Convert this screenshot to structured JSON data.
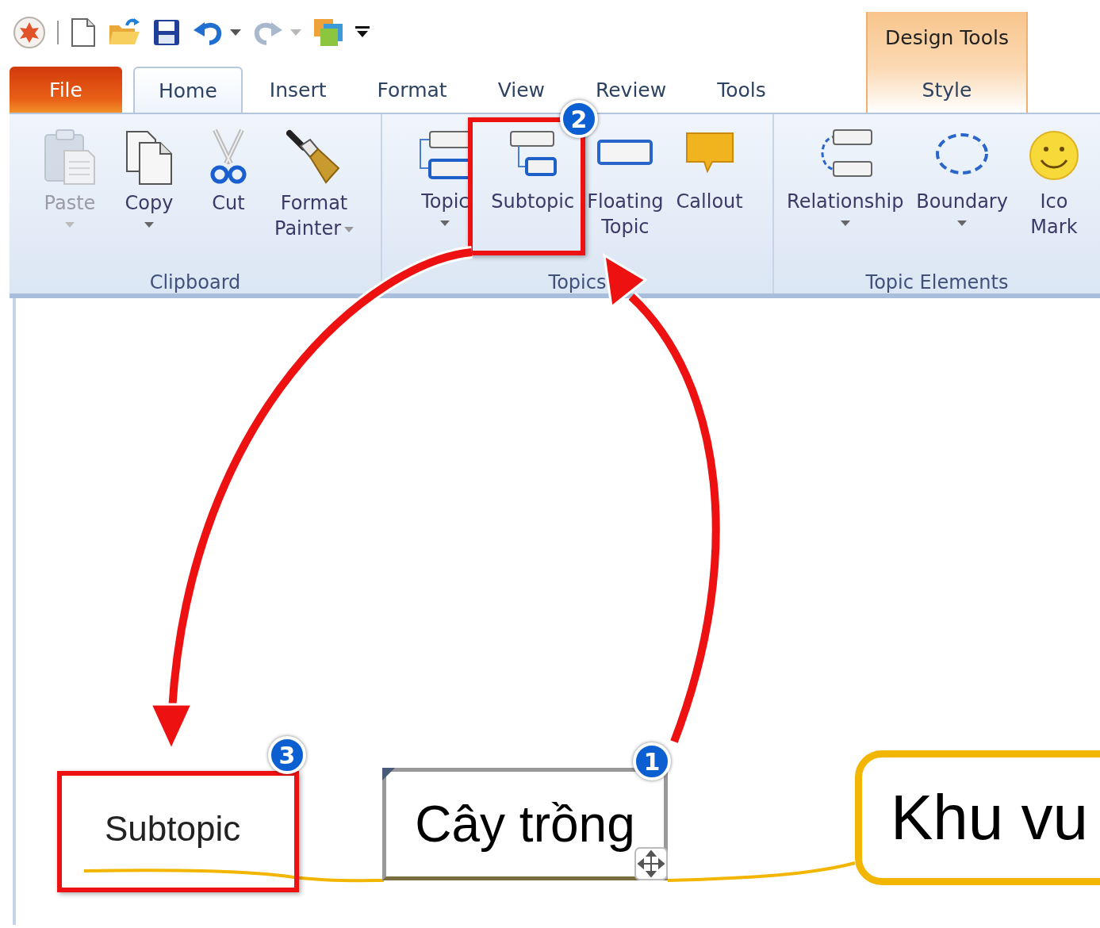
{
  "quick_access": [
    {
      "kind": "logo"
    },
    {
      "kind": "separator"
    },
    {
      "kind": "new"
    },
    {
      "kind": "open"
    },
    {
      "kind": "save"
    },
    {
      "kind": "undo",
      "disabled": false
    },
    {
      "kind": "undo-menu",
      "disabled": false
    },
    {
      "kind": "redo",
      "disabled": true
    },
    {
      "kind": "redo-menu",
      "disabled": true
    },
    {
      "kind": "windows"
    },
    {
      "kind": "customize"
    }
  ],
  "tabs": [
    {
      "label": "File",
      "kind": "file",
      "selected": false
    },
    {
      "label": "Home",
      "kind": "normal",
      "selected": true
    },
    {
      "label": "Insert",
      "kind": "normal",
      "selected": false
    },
    {
      "label": "Format",
      "kind": "normal",
      "selected": false
    },
    {
      "label": "View",
      "kind": "normal",
      "selected": false
    },
    {
      "label": "Review",
      "kind": "normal",
      "selected": false
    },
    {
      "label": "Tools",
      "kind": "normal",
      "selected": false
    }
  ],
  "contextual_tabs": {
    "title": "Design Tools",
    "tabs": [
      {
        "label": "Style",
        "selected": false
      }
    ]
  },
  "ribbon": {
    "groups": [
      {
        "label": "Clipboard",
        "buttons": [
          {
            "label": "Paste",
            "dropdown": true,
            "disabled": true
          },
          {
            "label": "Copy",
            "dropdown": true,
            "disabled": false
          },
          {
            "label": "Cut",
            "dropdown": false,
            "disabled": false
          },
          {
            "label": "Format\nPainter",
            "dropdown": true,
            "disabled": false
          }
        ]
      },
      {
        "label": "Topics",
        "buttons": [
          {
            "label": "Topic",
            "dropdown": true,
            "disabled": false
          },
          {
            "label": "Subtopic",
            "dropdown": false,
            "disabled": false
          },
          {
            "label": "Floating\nTopic",
            "dropdown": false,
            "disabled": false
          },
          {
            "label": "Callout",
            "dropdown": false,
            "disabled": false
          }
        ]
      },
      {
        "label": "Topic Elements",
        "buttons": [
          {
            "label": "Relationship",
            "dropdown": true,
            "disabled": false
          },
          {
            "label": "Boundary",
            "dropdown": true,
            "disabled": false
          },
          {
            "label": "Ico\nMark",
            "dropdown": false,
            "disabled": false
          }
        ]
      }
    ]
  },
  "map": {
    "nodes": [
      {
        "kind": "subtopic",
        "text": "Subtopic",
        "selected": false
      },
      {
        "kind": "topic",
        "text": "Cây trồng",
        "selected": true
      },
      {
        "kind": "main",
        "text": "Khu vu",
        "selected": false
      }
    ]
  },
  "annotations": {
    "badges": [
      "1",
      "2",
      "3"
    ]
  }
}
